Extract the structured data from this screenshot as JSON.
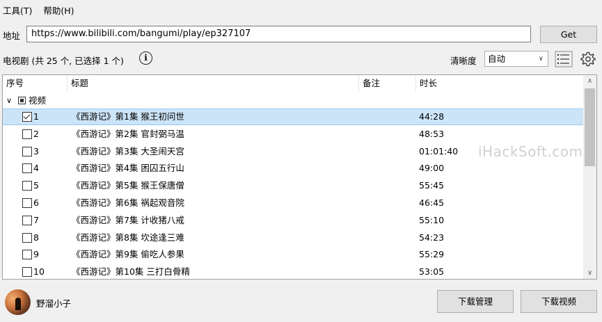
{
  "menu": {
    "tools": "工具(T)",
    "help": "帮助(H)"
  },
  "address": {
    "label": "地址",
    "value": "https://www.bilibili.com/bangumi/play/ep327107",
    "get_label": "Get"
  },
  "info": {
    "summary": "电视剧 (共 25 个, 已选择 1 个)",
    "info_icon": "i",
    "quality_label": "清晰度",
    "quality_value": "自动"
  },
  "table": {
    "columns": [
      "序号",
      "标题",
      "备注",
      "时长"
    ],
    "group_label": "视频",
    "rows": [
      {
        "no": "1",
        "title": "《西游记》第1集 猴王初问世",
        "duration": "44:28",
        "checked": true,
        "selected": true
      },
      {
        "no": "2",
        "title": "《西游记》第2集 官封弼马温",
        "duration": "48:53",
        "checked": false
      },
      {
        "no": "3",
        "title": "《西游记》第3集 大圣闹天宫",
        "duration": "01:01:40",
        "checked": false
      },
      {
        "no": "4",
        "title": "《西游记》第4集 困囚五行山",
        "duration": "49:00",
        "checked": false
      },
      {
        "no": "5",
        "title": "《西游记》第5集 猴王保唐僧",
        "duration": "55:45",
        "checked": false
      },
      {
        "no": "6",
        "title": "《西游记》第6集 祸起观音院",
        "duration": "46:45",
        "checked": false
      },
      {
        "no": "7",
        "title": "《西游记》第7集 计收猪八戒",
        "duration": "55:10",
        "checked": false
      },
      {
        "no": "8",
        "title": "《西游记》第8集 坎途逢三难",
        "duration": "54:23",
        "checked": false
      },
      {
        "no": "9",
        "title": "《西游记》第9集 偷吃人参果",
        "duration": "55:29",
        "checked": false
      },
      {
        "no": "10",
        "title": "《西游记》第10集 三打白骨精",
        "duration": "53:05",
        "checked": false
      }
    ]
  },
  "watermark": "iHackSoft.com",
  "footer": {
    "username": "野溜小子",
    "download_manager": "下载管理",
    "download_video": "下载视频"
  },
  "icons": {
    "list": "list-settings-icon",
    "gear": "gear-icon",
    "collapse": "chevron-down-icon"
  }
}
